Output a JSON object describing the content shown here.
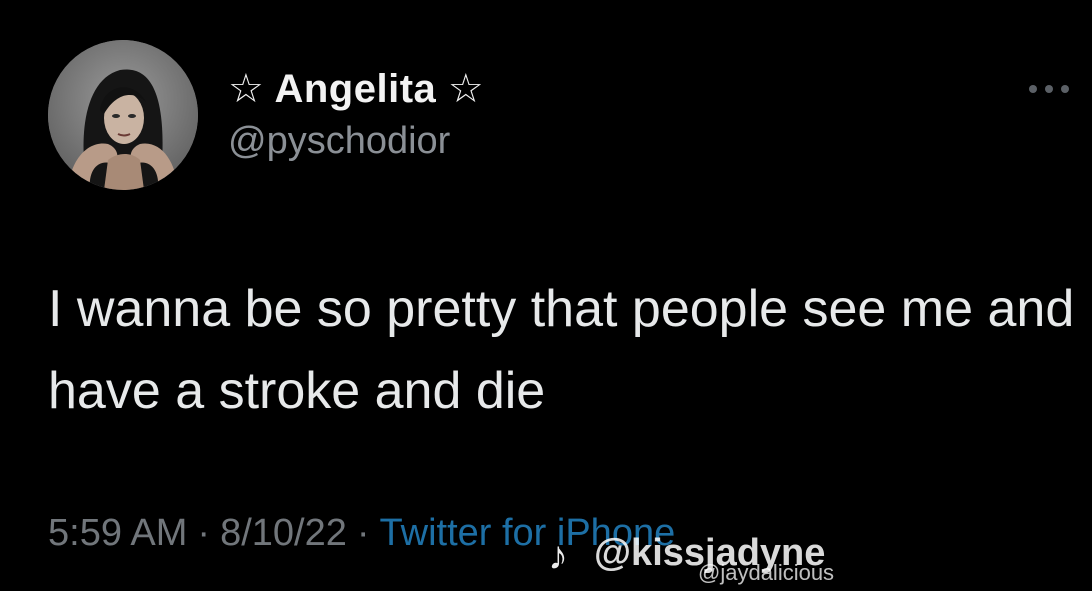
{
  "tweet": {
    "display_name": "☆ Angelita ☆",
    "handle": "@pyschodior",
    "text": "I wanna be so pretty that people see me and have a stroke and die",
    "time": "5:59 AM",
    "separator": "·",
    "date": "8/10/22",
    "source": "Twitter for iPhone",
    "more_icon": "more-horizontal-icon",
    "avatar_icon": "profile-photo"
  },
  "watermark": {
    "logo_icon": "tiktok-logo-icon",
    "name": "@kissjadyne",
    "handle": "@jaydalicious"
  },
  "colors": {
    "background": "#000000",
    "text_primary": "#e7e9ea",
    "text_secondary": "#71767b",
    "link": "#1d6fa5"
  }
}
